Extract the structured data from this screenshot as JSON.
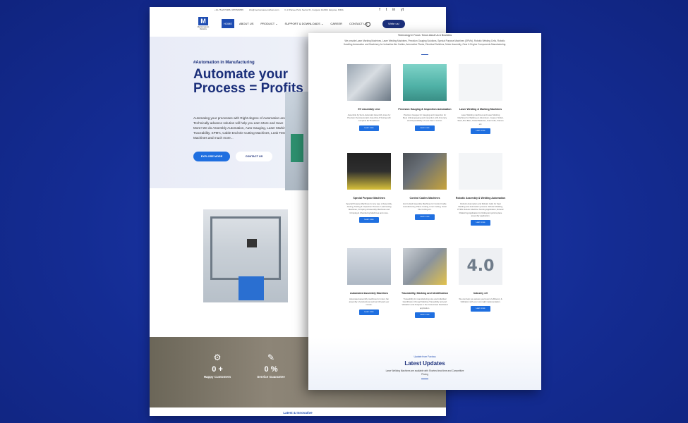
{
  "topbar": {
    "phone": "+91-75x2073386, 9876584565",
    "email": "info@metrosmasoonsthera.com",
    "address": "F-1/ Parsee Park, Sector 61, Gurgaon 122001 Haryana, INDIA"
  },
  "social": [
    "f",
    "t",
    "in",
    "yt"
  ],
  "logo": {
    "mark": "M",
    "text": "Metrosmasoon Robotics"
  },
  "nav": {
    "items": [
      "HOME",
      "ABOUT US",
      "PRODUCT ⌄",
      "SUPPORT & DOWNLOADS ⌄",
      "CAREER",
      "CONTACT US"
    ],
    "write_btn": "Write us!"
  },
  "hero": {
    "tag": "#Automation in Manufacturing",
    "title": "Automate your Process = Profits",
    "desc": "Automating your processes with Right degree of Automation and Technically advance solution will help you earn More and Save More! We do Assembly Automation, Auto Gauging, Laser Marking & Traceability, SPM's, Cable End Die Cutting Machines, Leak Testing Machines and much more...",
    "btn_explore": "EXPLORE MORE",
    "btn_contact": "CONTACT US"
  },
  "stats": [
    {
      "icon": "⚙",
      "num": "0 +",
      "label": "Happy Customers"
    },
    {
      "icon": "✎",
      "num": "0 %",
      "label": "Service Guarantee"
    }
  ],
  "bottom_label": "Latest & Innovative",
  "right": {
    "heading": "Technology in Focus ·Know about Us & Business",
    "intro": "We provide Laser Marking Machines, Laser Welding Machines, Precision Gauging Solutions, Special Purpose Machines (SPM's), Robotic Welding Cells, Robotic Handling Automation and Machinery for Industries like Cables, Automotive Plants, Electrical Switches, Motor Assembly, Gear & Engine Components Manufacturing.",
    "button_label": "Learn more",
    "cards": [
      {
        "title": "EV Assembly Line",
        "desc": "Assemble by Semi-Automatic Assembly Lines by Precision Semiautomatic Assembly & Testing with complete EV Readiness."
      },
      {
        "title": "Precision Gauging & Inspection Automation",
        "desc": "Precision Gauges for Gauging and inspection for Meet critical gauging and inspection with Accuracy and Repeatability of Less than 4 micron."
      },
      {
        "title": "Laser Welding & Marking Machines",
        "desc": "Laser Welding machines and Laser Marking Machines for Welding on Aluminium, Copper, Nickel, Steel, Bus Bars, Nickel Batteries, Fuel Cells, Frames etc."
      },
      {
        "title": "Special Purpose Machines",
        "desc": "Special Purpose Machines for any type of Assembly, Joining, Testing & Inspection Process. Leak testing Machines, Crimping & Assembly Machines and Crimping & Chamfering Machines and more."
      },
      {
        "title": "Control Cables Machines",
        "desc": "End to End Assembly Machines for Control Cable manufacturing. Plane Cutting, Inner Cutting, Outer Die Cutting etc."
      },
      {
        "title": "Robotic Assembly & Welding Automation",
        "desc": "Robotic Automation and Robotic Cells for Spot Welding and automation process. Robotic Welding, PTMG Robotic Machine Tending Application, Robotic Palletizing Application for Multi-point pick & place assembly application."
      },
      {
        "title": "Automated Assembly Machines",
        "desc": "Automated assembly machines for motor, fan assembly of products as well as 100 parts per minute."
      },
      {
        "title": "Traceability, Marking and Identification",
        "desc": "Traceability for manufacturing Line and individual Identification through Marking Traceability and part Validation and Analysis in the Customised Dedicated application."
      },
      {
        "title": "Industry 4.0",
        "desc": "We can help you access your level of efficiency & Utilization with your own right implementation."
      }
    ],
    "latest": {
      "tag": "Update from Factory",
      "title": "Latest Updates",
      "desc": "Laser Welding Machines are available with Shortest lead time and Competitive Pricing"
    }
  },
  "icons": {
    "search": "search-icon",
    "facebook": "facebook-icon",
    "twitter": "twitter-icon",
    "linkedin": "linkedin-icon",
    "youtube": "youtube-icon"
  },
  "colors": {
    "background": "#132b92",
    "brand_navy": "#1b2f7a",
    "accent_blue": "#1f6fe0"
  }
}
